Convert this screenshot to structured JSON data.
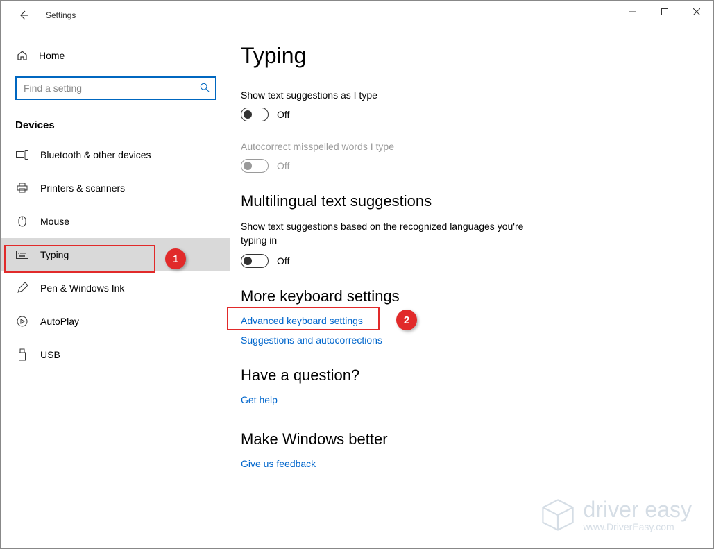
{
  "window": {
    "title": "Settings"
  },
  "sidebar": {
    "home_label": "Home",
    "search_placeholder": "Find a setting",
    "section_header": "Devices",
    "items": [
      {
        "label": "Bluetooth & other devices",
        "icon": "devices-icon"
      },
      {
        "label": "Printers & scanners",
        "icon": "printer-icon"
      },
      {
        "label": "Mouse",
        "icon": "mouse-icon"
      },
      {
        "label": "Typing",
        "icon": "keyboard-icon",
        "selected": true
      },
      {
        "label": "Pen & Windows Ink",
        "icon": "pen-icon"
      },
      {
        "label": "AutoPlay",
        "icon": "autoplay-icon"
      },
      {
        "label": "USB",
        "icon": "usb-icon"
      }
    ]
  },
  "main": {
    "page_title": "Typing",
    "settings": [
      {
        "label": "Show text suggestions as I type",
        "state": "Off",
        "disabled": false
      },
      {
        "label": "Autocorrect misspelled words I type",
        "state": "Off",
        "disabled": true
      }
    ],
    "sections": [
      {
        "heading": "Multilingual text suggestions",
        "desc": "Show text suggestions based on the recognized languages you're typing in",
        "toggle_state": "Off"
      },
      {
        "heading": "More keyboard settings",
        "links": [
          "Advanced keyboard settings",
          "Suggestions and autocorrections"
        ]
      },
      {
        "heading": "Have a question?",
        "links": [
          "Get help"
        ]
      },
      {
        "heading": "Make Windows better",
        "links": [
          "Give us feedback"
        ]
      }
    ]
  },
  "annotations": {
    "marker1": "1",
    "marker2": "2"
  },
  "watermark": {
    "line1": "driver easy",
    "line2": "www.DriverEasy.com"
  }
}
